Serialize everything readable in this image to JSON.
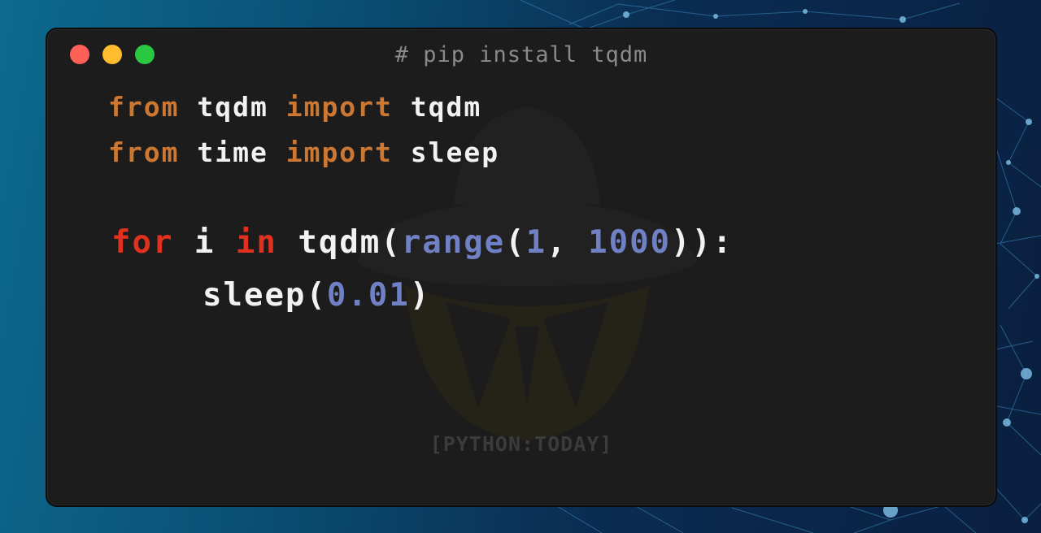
{
  "window": {
    "title": "# pip install tqdm",
    "traffic_lights": [
      "close",
      "minimize",
      "zoom"
    ]
  },
  "code": {
    "line1": {
      "t1": "from",
      "t2": " tqdm ",
      "t3": "import",
      "t4": " tqdm"
    },
    "line2": {
      "t1": "from",
      "t2": " time ",
      "t3": "import",
      "t4": " sleep"
    },
    "line3": {
      "t1": "for",
      "t2": " i ",
      "t3": "in",
      "t4": " tqdm(",
      "t5": "range",
      "t6": "(",
      "t7": "1",
      "t8": ", ",
      "t9": "1000",
      "t10": ")):"
    },
    "line4": {
      "t1": "sleep(",
      "t2": "0.01",
      "t3": ")"
    }
  },
  "watermark": {
    "text": "[PYTHON:TODAY]"
  },
  "colors": {
    "import_keyword": "#cc7832",
    "control_keyword": "#e0301e",
    "builtin_and_number": "#7080c4",
    "identifier": "#f2f2f2",
    "editor_bg": "#1c1c1c",
    "traffic_red": "#fe5f57",
    "traffic_yellow": "#febc2e",
    "traffic_green": "#29c840"
  }
}
